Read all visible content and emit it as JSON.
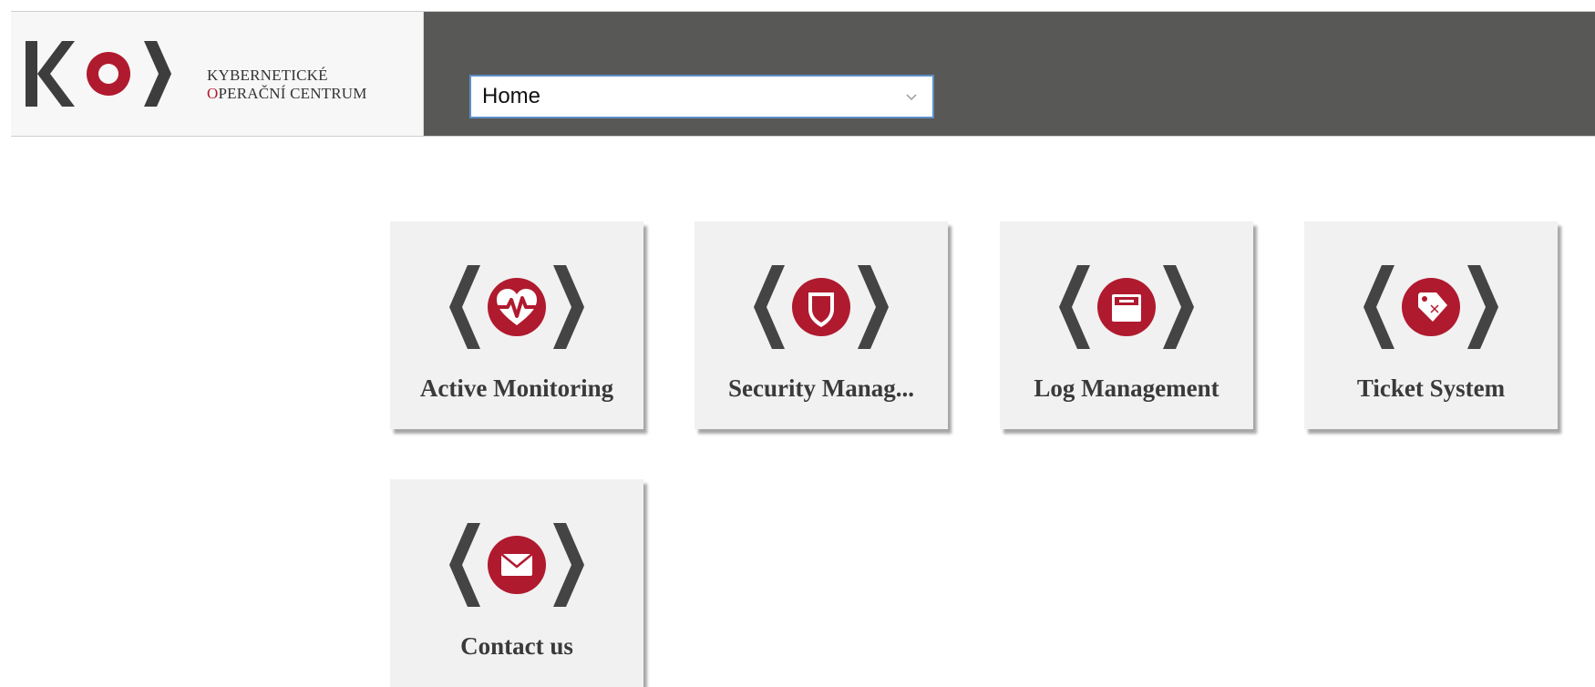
{
  "header": {
    "brand": {
      "logo_icon": "ko-logo-icon",
      "line1": "KYBERNETICKÉ",
      "line2": "OPERAČNÍ CENTRUM",
      "accent_color": "#b01a2e",
      "mark_color": "#3d3d3d"
    },
    "page_select": {
      "value": "Home",
      "chevron_icon": "chevron-down-icon"
    },
    "nav_color": "#585856"
  },
  "tiles": [
    {
      "label": "Active Monitoring",
      "icon": "heartbeat-icon"
    },
    {
      "label": "Security Manag...",
      "icon": "shield-icon"
    },
    {
      "label": "Log Management",
      "icon": "archive-icon"
    },
    {
      "label": "Ticket System",
      "icon": "tag-icon"
    },
    {
      "label": "Contact us",
      "icon": "envelope-icon"
    }
  ]
}
